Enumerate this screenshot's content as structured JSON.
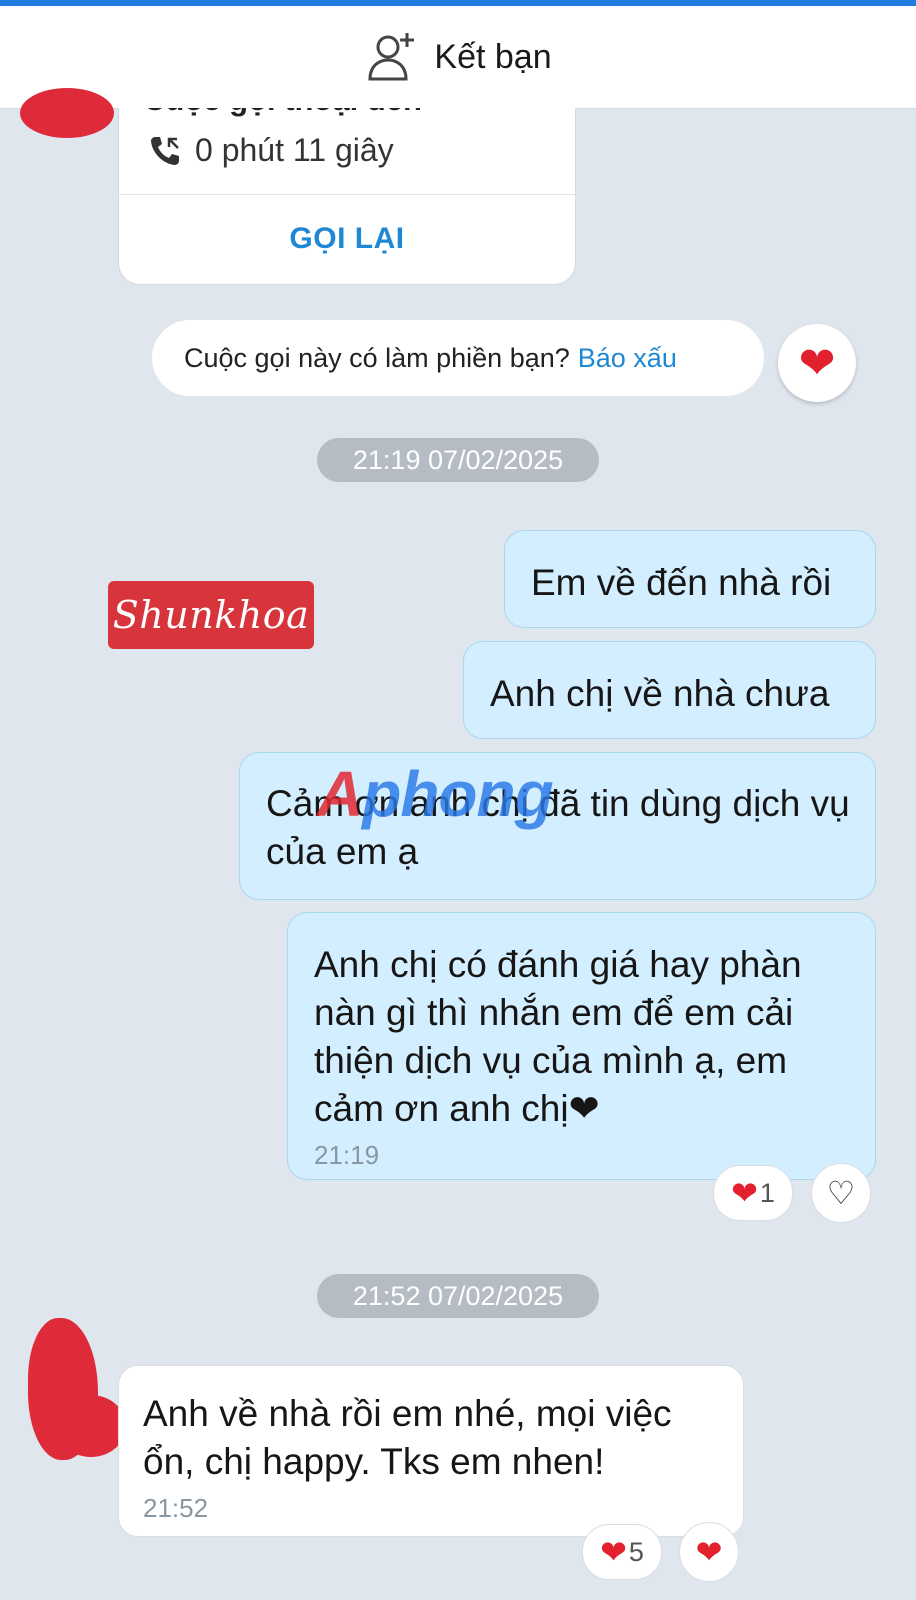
{
  "header": {
    "add_friend_label": "Kết bạn"
  },
  "call_card": {
    "title_cut": "Cuộc gọi thoại đến",
    "duration": "0 phút 11 giây",
    "callback_label": "GỌI LẠI"
  },
  "call_prompt": {
    "question": "Cuộc gọi này có làm phiền bạn?",
    "report_link": "Báo xấu",
    "reaction_icon": "heart"
  },
  "time_chips": [
    "21:19 07/02/2025",
    "21:52 07/02/2025"
  ],
  "watermarks": {
    "shop": "Shunkhoa",
    "brand_a": "A",
    "brand_rest": "phong"
  },
  "messages": [
    {
      "direction": "out",
      "text": "Em về đến nhà rồi"
    },
    {
      "direction": "out",
      "text": "Anh chị về nhà chưa"
    },
    {
      "direction": "out",
      "text": "Cảm ơn anh chị đã tin dùng dịch vụ của em ạ"
    },
    {
      "direction": "out",
      "text": "Anh chị có đánh giá hay phàn nàn gì thì nhắn em để em cải thiện dịch vụ của mình ạ, em cảm ơn anh chị❤",
      "time": "21:19",
      "reaction_count": "1"
    },
    {
      "direction": "in",
      "text": "Anh về nhà rồi em nhé, mọi việc ổn, chị happy. Tks em nhen!",
      "time": "21:52",
      "reaction_count": "5"
    }
  ],
  "colors": {
    "accent": "#1e88d4",
    "outgoing_bubble": "#d3efff",
    "background": "#dfe6ee",
    "heart": "#e3202e"
  }
}
